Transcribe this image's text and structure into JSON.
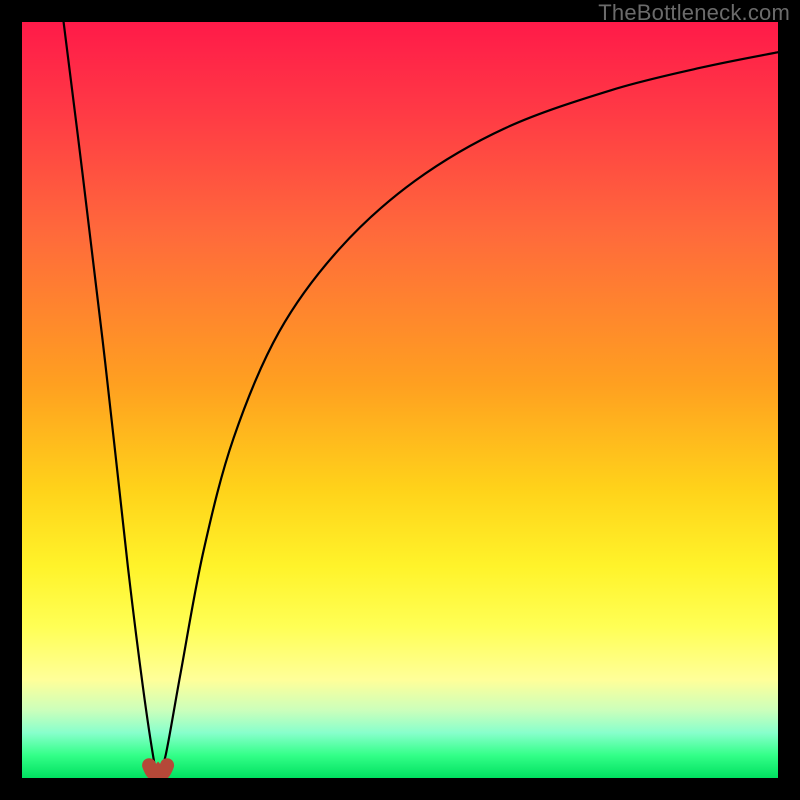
{
  "watermark": "TheBottleneck.com",
  "chart_data": {
    "type": "line",
    "title": "",
    "xlabel": "",
    "ylabel": "",
    "xlim": [
      0,
      100
    ],
    "ylim": [
      0,
      100
    ],
    "grid": false,
    "legend": false,
    "description": "Gradient background from red (top, high bottleneck) to green (bottom, no bottleneck). Two black curves descend into a sharp minimum near x≈18 and then rise; the right arm rises asymptotically toward the top right.",
    "minimum": {
      "x": 18,
      "y": 0.5
    },
    "series": [
      {
        "name": "left-arm",
        "points": [
          {
            "x": 5.5,
            "y": 100
          },
          {
            "x": 8,
            "y": 80
          },
          {
            "x": 11,
            "y": 55
          },
          {
            "x": 14,
            "y": 28
          },
          {
            "x": 16,
            "y": 12
          },
          {
            "x": 17.5,
            "y": 2
          },
          {
            "x": 18,
            "y": 0.5
          }
        ]
      },
      {
        "name": "right-arm",
        "points": [
          {
            "x": 18,
            "y": 0.5
          },
          {
            "x": 19,
            "y": 3
          },
          {
            "x": 21,
            "y": 14
          },
          {
            "x": 24,
            "y": 30
          },
          {
            "x": 28,
            "y": 45
          },
          {
            "x": 34,
            "y": 59
          },
          {
            "x": 42,
            "y": 70
          },
          {
            "x": 52,
            "y": 79
          },
          {
            "x": 64,
            "y": 86
          },
          {
            "x": 78,
            "y": 91
          },
          {
            "x": 90,
            "y": 94
          },
          {
            "x": 100,
            "y": 96
          }
        ]
      }
    ],
    "marker": {
      "shape": "w",
      "x": 18,
      "y": 0.5,
      "color": "#b54838"
    },
    "background_gradient": {
      "top_color": "#ff1a49",
      "bottom_color": "#00e060",
      "bands": [
        "#ffff55",
        "#ffff99",
        "#ccffbb",
        "#88ffcc",
        "#33ff88"
      ]
    }
  }
}
